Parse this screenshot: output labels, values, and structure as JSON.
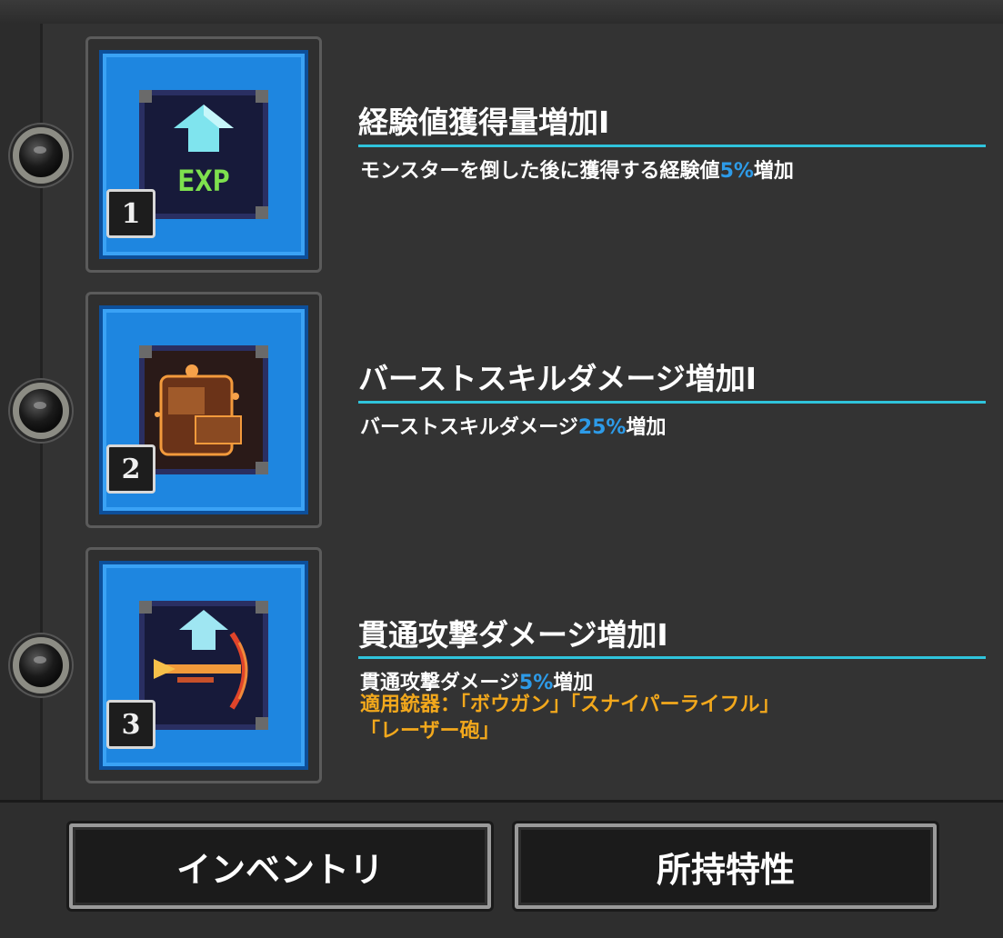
{
  "skills": [
    {
      "index": "1",
      "icon": "exp-up-icon",
      "title": "経験値獲得量増加I",
      "desc_prefix": "モンスターを倒した後に獲得する経験値",
      "desc_value": "5%",
      "desc_suffix": "増加"
    },
    {
      "index": "2",
      "icon": "burst-fist-icon",
      "title": "バーストスキルダメージ増加I",
      "desc_prefix": "バーストスキルダメージ",
      "desc_value": "25%",
      "desc_suffix": "増加"
    },
    {
      "index": "3",
      "icon": "pierce-arrow-icon",
      "title": "貫通攻撃ダメージ増加I",
      "desc_prefix": "貫通攻撃ダメージ",
      "desc_value": "5%",
      "desc_suffix": "増加",
      "weapons_line1": "適用銃器：「ボウガン」「スナイパーライフル」",
      "weapons_line2": "「レーザー砲」"
    }
  ],
  "icon_labels": {
    "exp": "EXP"
  },
  "buttons": {
    "inventory": "インベントリ",
    "owned_traits": "所持特性"
  },
  "colors": {
    "highlight": "#2d9be8",
    "weapon_text": "#f2a81c",
    "rule": "#2fc4dc",
    "icon_bg": "#1e86e0"
  }
}
